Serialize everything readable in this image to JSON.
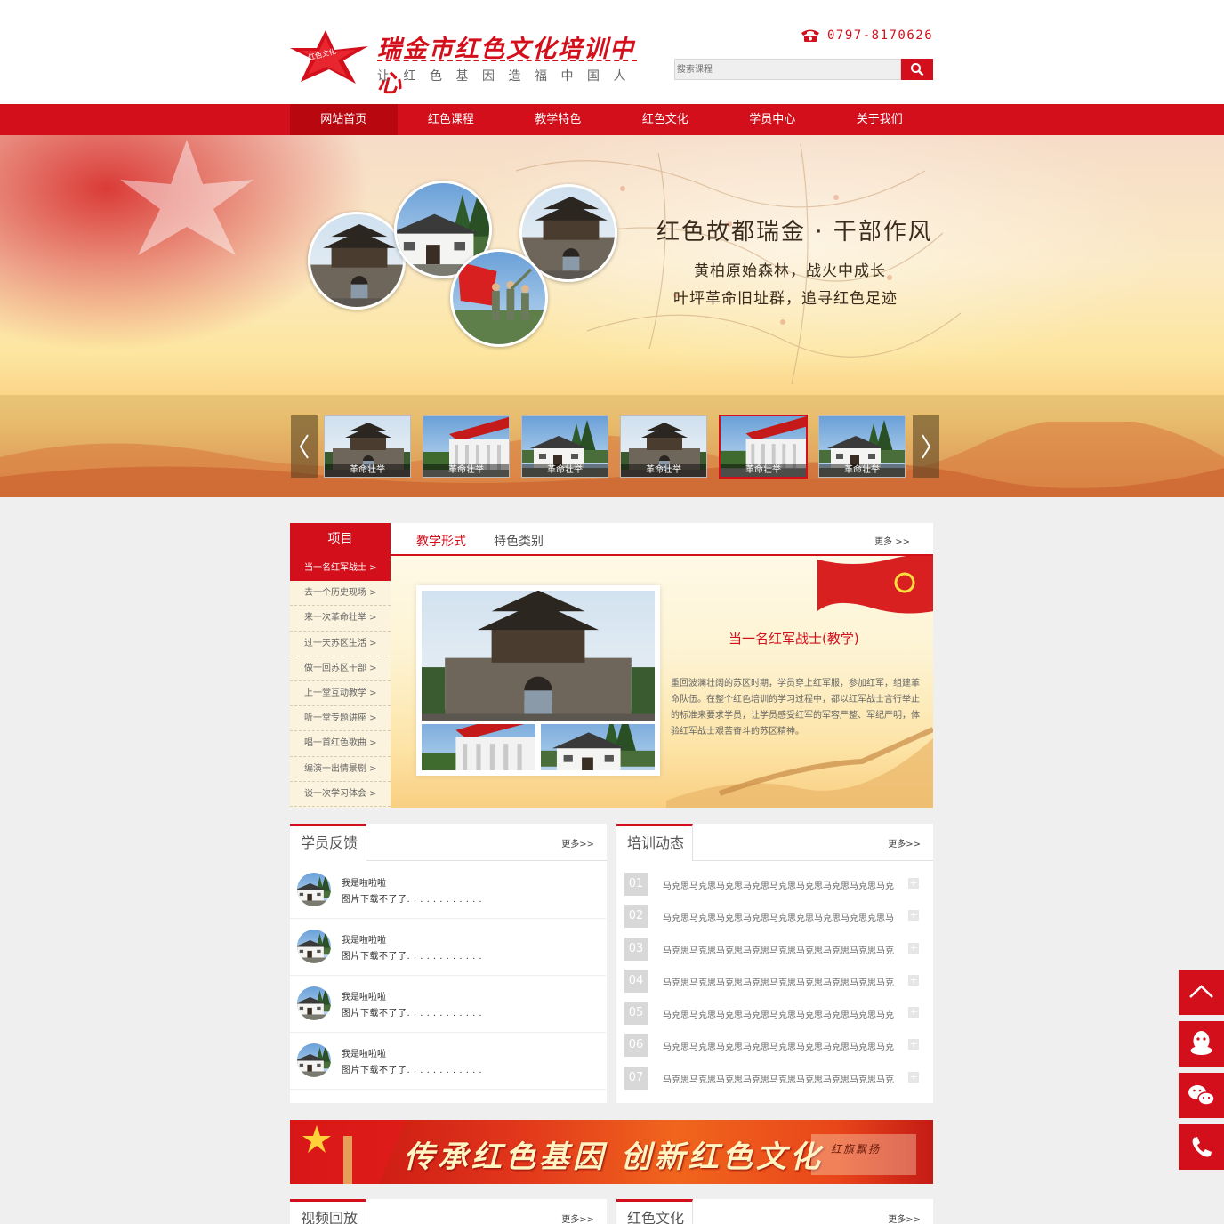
{
  "header": {
    "logo_badge": "红色文化",
    "title": "瑞金市红色文化培训中心",
    "slogan": "让红色基因造福中国人",
    "phone": "0797-8170626",
    "search_placeholder": "搜索课程"
  },
  "nav": {
    "items": [
      "网站首页",
      "红色课程",
      "教学特色",
      "红色文化",
      "学员中心",
      "关于我们"
    ],
    "active_index": 0
  },
  "banner": {
    "title": "红色故都瑞金 · 干部作风",
    "line1": "黄柏原始森林，战火中成长",
    "line2": "叶坪革命旧址群，追寻红色足迹",
    "thumbs": [
      "革命壮举",
      "革命壮举",
      "革命壮举",
      "革命壮举",
      "革命壮举",
      "革命壮举"
    ],
    "active_thumb": 4,
    "prev_icon": "chevron-left-icon",
    "next_icon": "chevron-right-icon"
  },
  "projects": {
    "header": "项目",
    "items": [
      "当一名红军战士 >",
      "去一个历史现场 >",
      "来一次革命壮举 >",
      "过一天苏区生活 >",
      "做一回苏区干部 >",
      "上一堂互动教学 >",
      "听一堂专题讲座 >",
      "唱一首红色歌曲 >",
      "编演一出情景剧 >",
      "谈一次学习体会 >"
    ],
    "active_index": 0,
    "tabs": [
      "教学形式",
      "特色类别"
    ],
    "more": "更多 >>",
    "feature_title": "当一名红军战士(教学)",
    "feature_desc": "重回波澜壮阔的苏区时期，学员穿上红军服，参加红军，组建革命队伍。在整个红色培训的学习过程中，都以红军战士言行举止的标准来要求学员，让学员感受红军的军容严整、军纪严明，体验红军战士艰苦奋斗的苏区精神。"
  },
  "feedback": {
    "title": "学员反馈",
    "more": "更多>>",
    "items": [
      {
        "name": "我是啦啦啦",
        "text": "图片下载不了了. . . . . . . . . . . ."
      },
      {
        "name": "我是啦啦啦",
        "text": "图片下载不了了. . . . . . . . . . . ."
      },
      {
        "name": "我是啦啦啦",
        "text": "图片下载不了了. . . . . . . . . . . ."
      },
      {
        "name": "我是啦啦啦",
        "text": "图片下载不了了. . . . . . . . . . . ."
      }
    ]
  },
  "news": {
    "title": "培训动态",
    "more": "更多>>",
    "items": [
      {
        "num": "01",
        "title": "马克思马克思马克思马克思马克思马克思马克思马克思马克"
      },
      {
        "num": "02",
        "title": "马克思马克思马克思马克思马克思克思马克思马克思克思马"
      },
      {
        "num": "03",
        "title": "马克思马克思马克思马克思马克思马克思马克思马克思马克"
      },
      {
        "num": "04",
        "title": "马克思马克思马克思马克思马克思马克思马克思马克思马克"
      },
      {
        "num": "05",
        "title": "马克思马克思马克思马克思马克思马克思马克思马克思马克"
      },
      {
        "num": "06",
        "title": "马克思马克思马克思马克思马克思马克思马克思马克思马克"
      },
      {
        "num": "07",
        "title": "马克思马克思马克思马克思马克思马克思马克思马克思马克"
      }
    ],
    "plus": "+"
  },
  "promo": {
    "text": "传承红色基因 创新红色文化",
    "seal": "红旗飘扬"
  },
  "bottom": {
    "video_title": "视频回放",
    "culture_title": "红色文化",
    "more": "更多>>"
  },
  "float_buttons": [
    "back-to-top-icon",
    "qq-icon",
    "wechat-icon",
    "phone-icon"
  ],
  "colors": {
    "brand_red": "#d20f1b",
    "nav_active": "#b8070f",
    "page_bg": "#efefef"
  }
}
